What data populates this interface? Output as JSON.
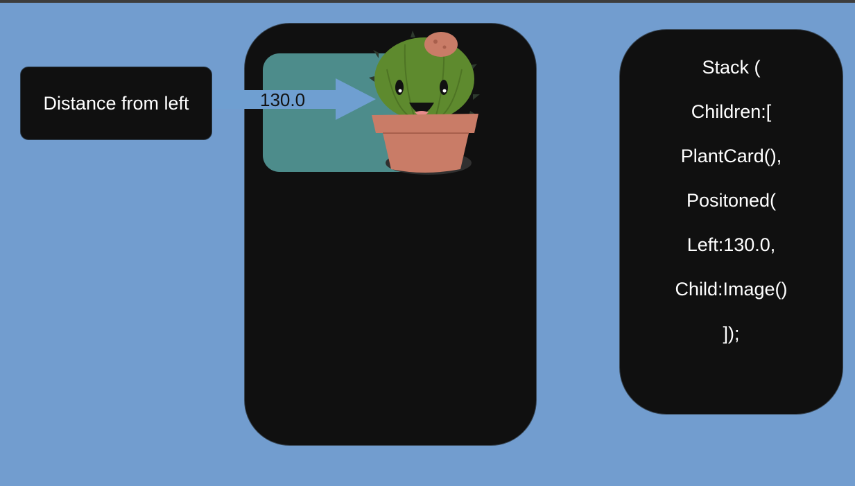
{
  "label": {
    "text": "Distance from left"
  },
  "arrow": {
    "value": "130.0"
  },
  "code": {
    "lines": [
      "Stack (",
      "Children:[",
      "PlantCard(),",
      "Positoned(",
      "Left:130.0,",
      "Child:Image()",
      "]);"
    ]
  },
  "colors": {
    "background": "#729dcf",
    "panel": "#101010",
    "plant_card": "#4d8c8b",
    "arrow": "#6f9fd1",
    "cactus_body": "#5e8a2e",
    "pot": "#c97c67"
  },
  "icons": {
    "plant": "cactus-in-pot-icon"
  }
}
